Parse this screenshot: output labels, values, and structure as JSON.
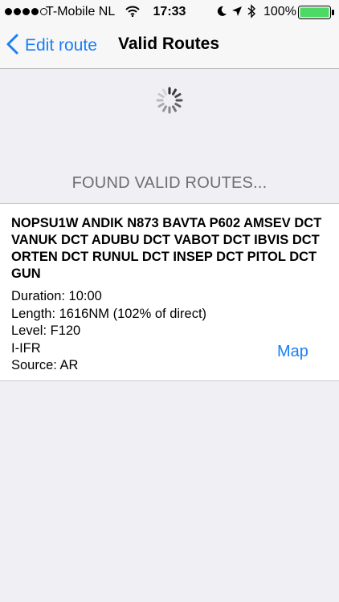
{
  "status_bar": {
    "carrier": "T-Mobile NL",
    "time": "17:33",
    "battery_percent": "100%",
    "signal_bars": 4,
    "signal_max": 5,
    "battery_level": 1.0,
    "battery_color": "#4cd964",
    "icons": [
      "signal-icon",
      "wifi-icon",
      "moon-icon",
      "location-icon",
      "bluetooth-icon",
      "battery-icon"
    ]
  },
  "nav": {
    "back_label": "Edit route",
    "title": "Valid Routes",
    "accent_color": "#1a7ef7"
  },
  "main": {
    "status_text": "FOUND VALID ROUTES...",
    "spinner_icon": "activity-spinner-icon"
  },
  "route": {
    "route_string": "NOPSU1W ANDIK N873 BAVTA P602 AMSEV DCT VANUK DCT ADUBU DCT VABOT DCT IBVIS DCT ORTEN DCT RUNUL DCT INSEP DCT PITOL DCT GUN",
    "duration": "Duration: 10:00",
    "length": "Length: 1616NM (102% of direct)",
    "level": "Level: F120",
    "rules": "I-IFR",
    "source": "Source: AR",
    "map_label": "Map"
  }
}
